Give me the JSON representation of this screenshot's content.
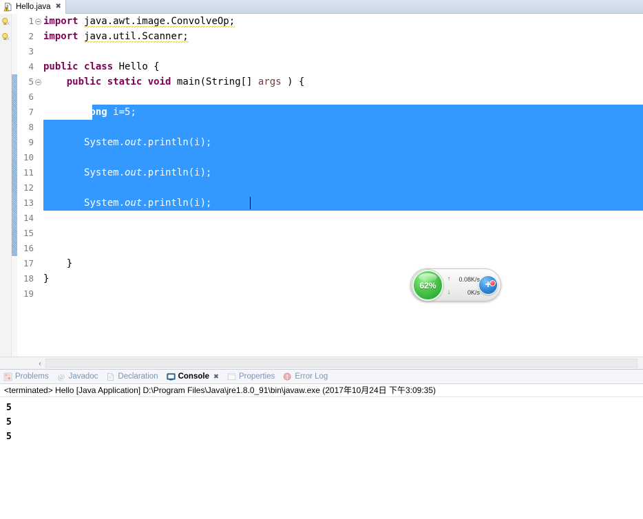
{
  "editor_tab": {
    "label": "Hello.java",
    "icon": "java-file-warning-icon",
    "close": "✖"
  },
  "code": {
    "lines": [
      {
        "num": "1",
        "fold": true,
        "warn": true,
        "selected": false
      },
      {
        "num": "2",
        "fold": false,
        "warn": true,
        "selected": false
      },
      {
        "num": "3",
        "fold": false,
        "warn": false,
        "selected": false
      },
      {
        "num": "4",
        "fold": false,
        "warn": false,
        "selected": false
      },
      {
        "num": "5",
        "fold": true,
        "warn": false,
        "selected": false
      },
      {
        "num": "6",
        "fold": false,
        "warn": false,
        "selected": true
      },
      {
        "num": "7",
        "fold": false,
        "warn": false,
        "selected": true
      },
      {
        "num": "8",
        "fold": false,
        "warn": false,
        "selected": true
      },
      {
        "num": "9",
        "fold": false,
        "warn": false,
        "selected": true
      },
      {
        "num": "10",
        "fold": false,
        "warn": false,
        "selected": true
      },
      {
        "num": "11",
        "fold": false,
        "warn": false,
        "selected": true
      },
      {
        "num": "12",
        "fold": false,
        "warn": false,
        "selected": true
      },
      {
        "num": "13",
        "fold": false,
        "warn": false,
        "selected": false
      },
      {
        "num": "14",
        "fold": false,
        "warn": false,
        "selected": false
      },
      {
        "num": "15",
        "fold": false,
        "warn": false,
        "selected": false
      },
      {
        "num": "16",
        "fold": false,
        "warn": false,
        "selected": false
      },
      {
        "num": "17",
        "fold": false,
        "warn": false,
        "selected": false
      },
      {
        "num": "18",
        "fold": false,
        "warn": false,
        "selected": false
      },
      {
        "num": "19",
        "fold": false,
        "warn": false,
        "selected": false
      }
    ],
    "text": {
      "l1_kw": "import",
      "l1_pkg": "java.awt.image.ConvolveOp;",
      "l2_kw": "import",
      "l2_pkg": "java.util.Scanner;",
      "l4_kw1": "public",
      "l4_kw2": "class",
      "l4_name": "Hello {",
      "l5_kw1": "public",
      "l5_kw2": "static",
      "l5_kw3": "void",
      "l5_sig": "main(String[]",
      "l5_param": "args",
      "l5_tail": ") {",
      "l6_kw": "long",
      "l6_rest": "i=5;",
      "l8": "System.",
      "l8_field": "out",
      "l8_rest": ".println(i);",
      "l10": "System.",
      "l10_field": "out",
      "l10_rest": ".println(i);",
      "l12": "System.",
      "l12_field": "out",
      "l12_rest": ".println(i);",
      "l16_brace": "}",
      "l17_brace": "}"
    }
  },
  "scrollbar": {
    "left_arrow": "‹"
  },
  "panel": {
    "tabs": [
      {
        "label": "Problems",
        "icon": "problems-icon",
        "active": false
      },
      {
        "label": "Javadoc",
        "icon": "javadoc-icon",
        "active": false
      },
      {
        "label": "Declaration",
        "icon": "declaration-icon",
        "active": false
      },
      {
        "label": "Console",
        "icon": "console-icon",
        "active": true
      },
      {
        "label": "Properties",
        "icon": "properties-icon",
        "active": false
      },
      {
        "label": "Error Log",
        "icon": "error-log-icon",
        "active": false
      }
    ],
    "close_glyph": "✖",
    "status": "<terminated> Hello [Java Application] D:\\Program Files\\Java\\jre1.8.0_91\\bin\\javaw.exe (2017年10月24日 下午3:09:35)",
    "output": [
      "5",
      "5",
      "5"
    ]
  },
  "net_widget": {
    "percent": "62%",
    "up_arrow": "↑",
    "up_rate": "0.08K/s",
    "down_arrow": "↓",
    "down_rate": "0K/s",
    "plus_glyph": "+"
  },
  "colors": {
    "selection": "#3399ff",
    "keyword": "#7f0055",
    "static_field": "#0000c0",
    "parameter": "#6a3e3e",
    "gauge_green": "#4cc64a",
    "tab_bg": "#d6dfee"
  }
}
